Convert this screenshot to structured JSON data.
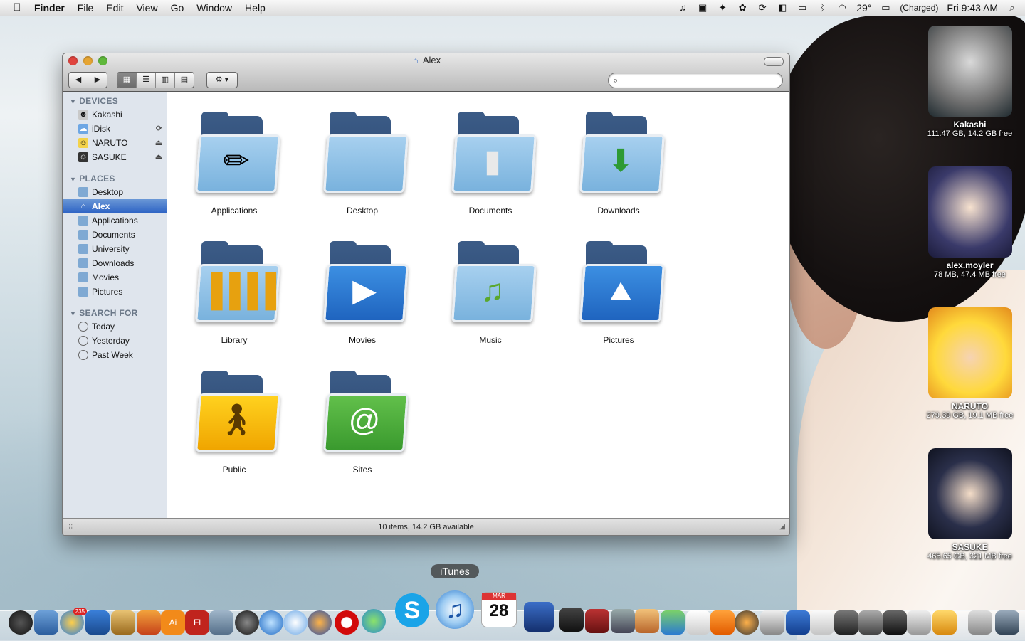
{
  "menubar": {
    "apple_icon": "apple-icon",
    "app_name": "Finder",
    "menus": [
      "File",
      "Edit",
      "View",
      "Go",
      "Window",
      "Help"
    ],
    "status_icons": [
      "music-note-icon",
      "clipboard-icon",
      "bird-icon",
      "paw-icon",
      "sync-icon",
      "timer-icon",
      "display-icon",
      "bluetooth-icon",
      "wifi-icon"
    ],
    "temperature": "29°",
    "battery": "(Charged)",
    "clock": "Fri 9:43 AM",
    "spotlight_icon": "search-icon"
  },
  "window": {
    "title": "Alex",
    "traffic_lights": {
      "close": "#e0443e",
      "minimize": "#e6a533",
      "zoom": "#5fb83b"
    },
    "nav_back": "◀",
    "nav_forward": "▶",
    "view_modes": [
      "icon-view",
      "list-view",
      "column-view",
      "coverflow-view"
    ],
    "action_label": "⚙ ▾",
    "search_placeholder": "",
    "status_text": "10 items, 14.2 GB available"
  },
  "sidebar": {
    "devices_heading": "DEVICES",
    "devices": [
      {
        "label": "Kakashi",
        "icon": "kakashi-drive-icon"
      },
      {
        "label": "iDisk",
        "icon": "idisk-icon",
        "action": "sync-icon"
      },
      {
        "label": "NARUTO",
        "icon": "naruto-drive-icon",
        "action": "eject-icon"
      },
      {
        "label": "SASUKE",
        "icon": "sasuke-drive-icon",
        "action": "eject-icon"
      }
    ],
    "places_heading": "PLACES",
    "places": [
      {
        "label": "Desktop"
      },
      {
        "label": "Alex",
        "selected": true
      },
      {
        "label": "Applications"
      },
      {
        "label": "Documents"
      },
      {
        "label": "University"
      },
      {
        "label": "Downloads"
      },
      {
        "label": "Movies"
      },
      {
        "label": "Pictures"
      }
    ],
    "search_heading": "SEARCH FOR",
    "searches": [
      {
        "label": "Today"
      },
      {
        "label": "Yesterday"
      },
      {
        "label": "Past Week"
      }
    ]
  },
  "folders": [
    {
      "label": "Applications",
      "emblem": "pencil-ruler-icon",
      "color": "#79b2dd"
    },
    {
      "label": "Desktop",
      "emblem": "plain-folder-icon",
      "color": "#79b2dd"
    },
    {
      "label": "Documents",
      "emblem": "document-icon",
      "color": "#79b2dd"
    },
    {
      "label": "Downloads",
      "emblem": "download-arrow-icon",
      "color": "#79b2dd"
    },
    {
      "label": "Library",
      "emblem": "books-icon",
      "color": "#79b2dd"
    },
    {
      "label": "Movies",
      "emblem": "play-icon",
      "color": "#2f7fd6"
    },
    {
      "label": "Music",
      "emblem": "music-note-icon",
      "color": "#79b2dd"
    },
    {
      "label": "Pictures",
      "emblem": "landscape-icon",
      "color": "#2f7fd6"
    },
    {
      "label": "Public",
      "emblem": "walking-person-icon",
      "color": "#f2b100"
    },
    {
      "label": "Sites",
      "emblem": "at-sign-icon",
      "color": "#4aa83b"
    }
  ],
  "desktop_drives": [
    {
      "name": "Kakashi",
      "size": "111.47 GB, 14.2 GB free"
    },
    {
      "name": "alex.moyler",
      "size": "78 MB, 47.4 MB free"
    },
    {
      "name": "NARUTO",
      "size": "279.39 GB, 19.1 MB free"
    },
    {
      "name": "SASUKE",
      "size": "465.65 GB, 321 MB free"
    }
  ],
  "dock": {
    "tooltip": "iTunes",
    "calendar_month": "MAR",
    "calendar_day": "28",
    "mail_badge": "235"
  }
}
